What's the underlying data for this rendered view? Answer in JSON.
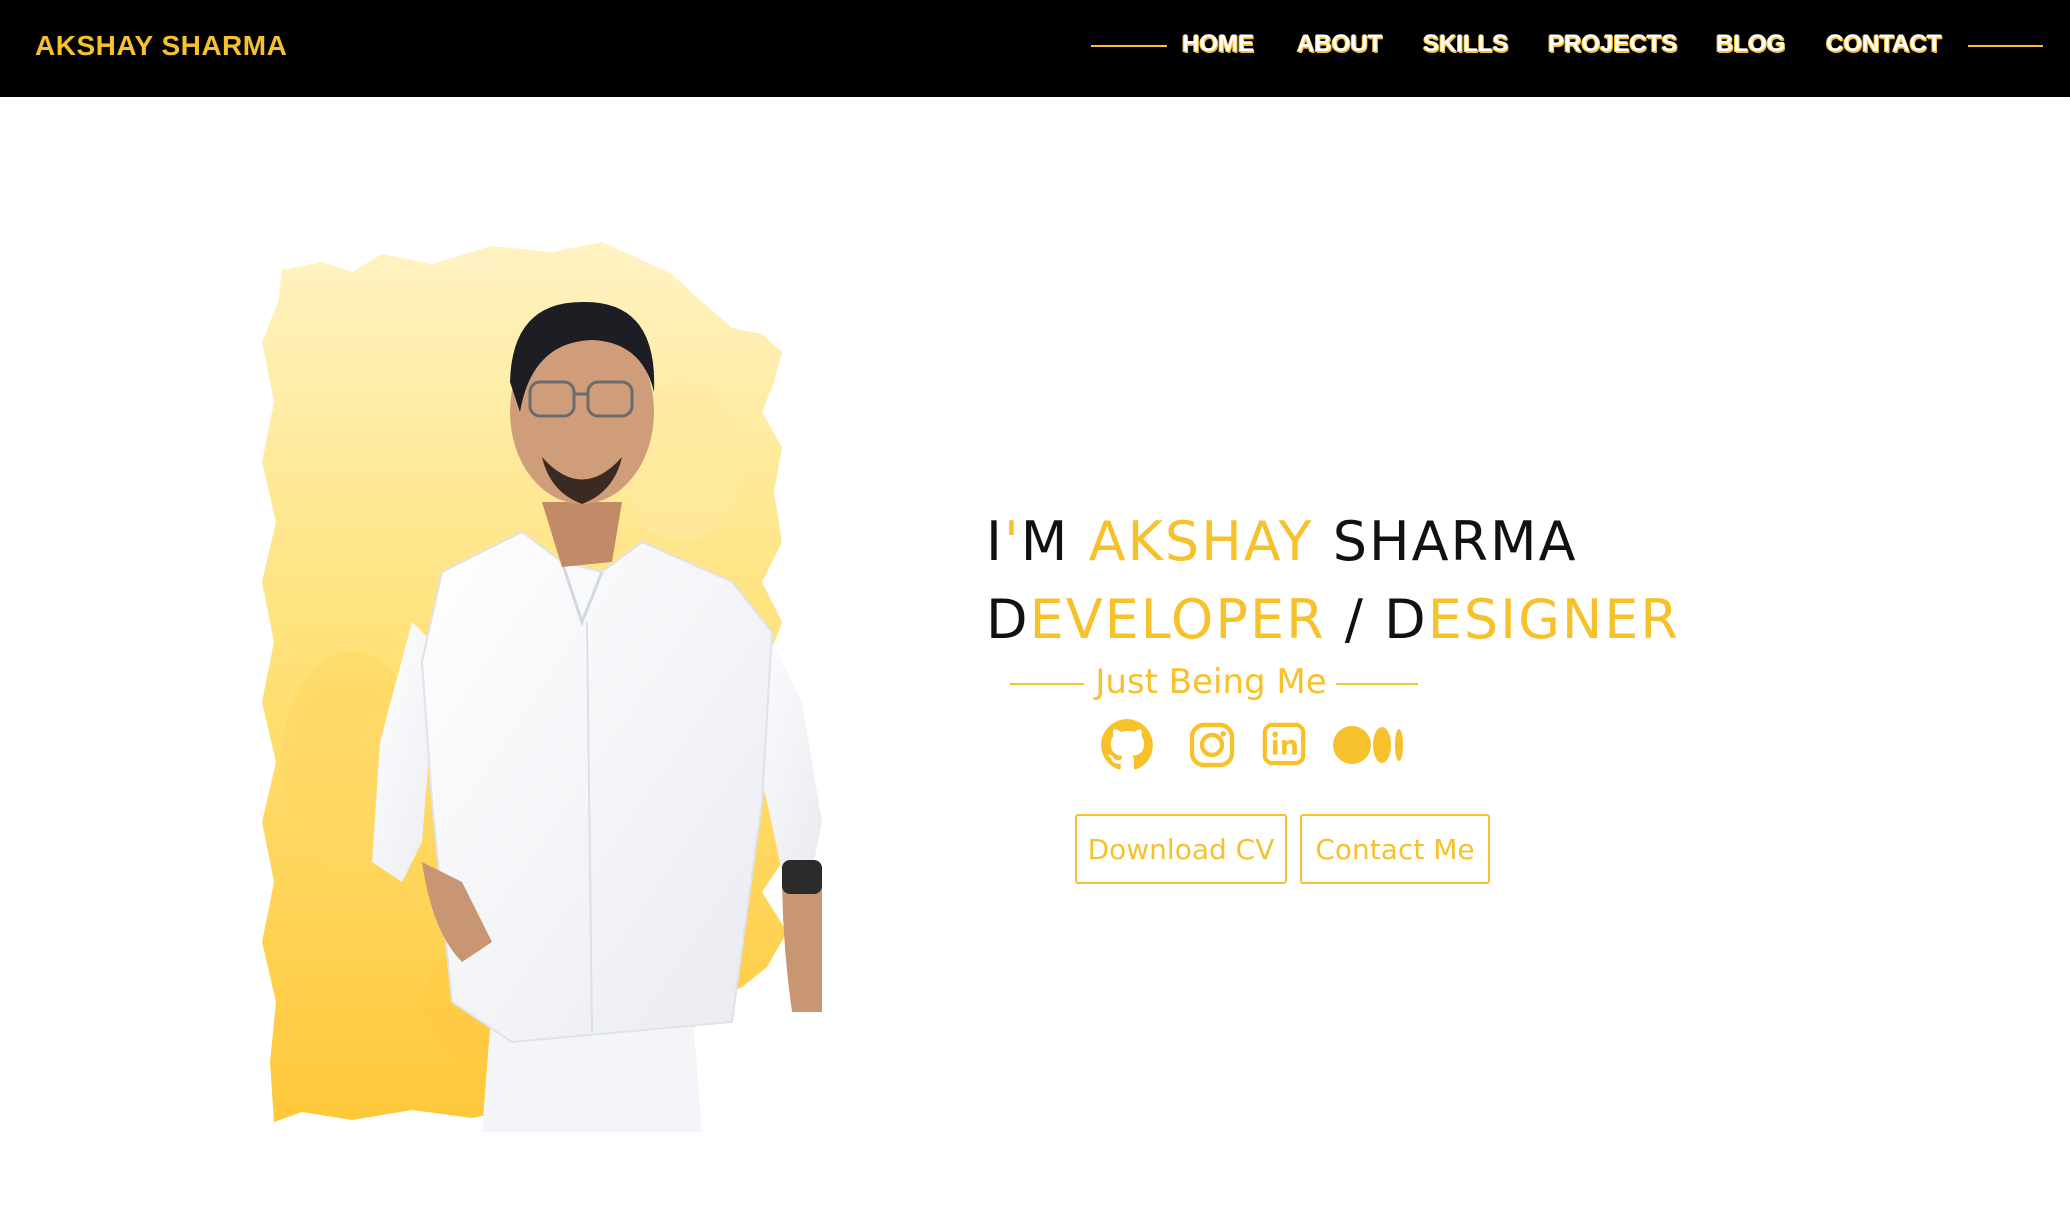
{
  "brand": {
    "name": "AKSHAY SHARMA"
  },
  "nav": {
    "items": [
      {
        "label": "HOME"
      },
      {
        "label": "ABOUT"
      },
      {
        "label": "SKILLS"
      },
      {
        "label": "PROJECTS"
      },
      {
        "label": "BLOG"
      },
      {
        "label": "CONTACT"
      }
    ]
  },
  "hero": {
    "line1": {
      "a": "I",
      "b": "'",
      "c": "M ",
      "d": "AKSHAY",
      "e": " SHARMA"
    },
    "line2": {
      "a": "D",
      "b": "EVELOPER",
      "c": " / D",
      "d": "ESIGNER"
    },
    "tagline": "Just Being Me",
    "social_icons": [
      "github-icon",
      "instagram-icon",
      "linkedin-icon",
      "medium-icon"
    ],
    "buttons": {
      "download_cv": "Download CV",
      "contact_me": "Contact Me"
    }
  },
  "colors": {
    "accent": "#f7c12c",
    "navbar_bg": "#000000",
    "page_bg": "#ffffff",
    "text_dark": "#111111"
  }
}
